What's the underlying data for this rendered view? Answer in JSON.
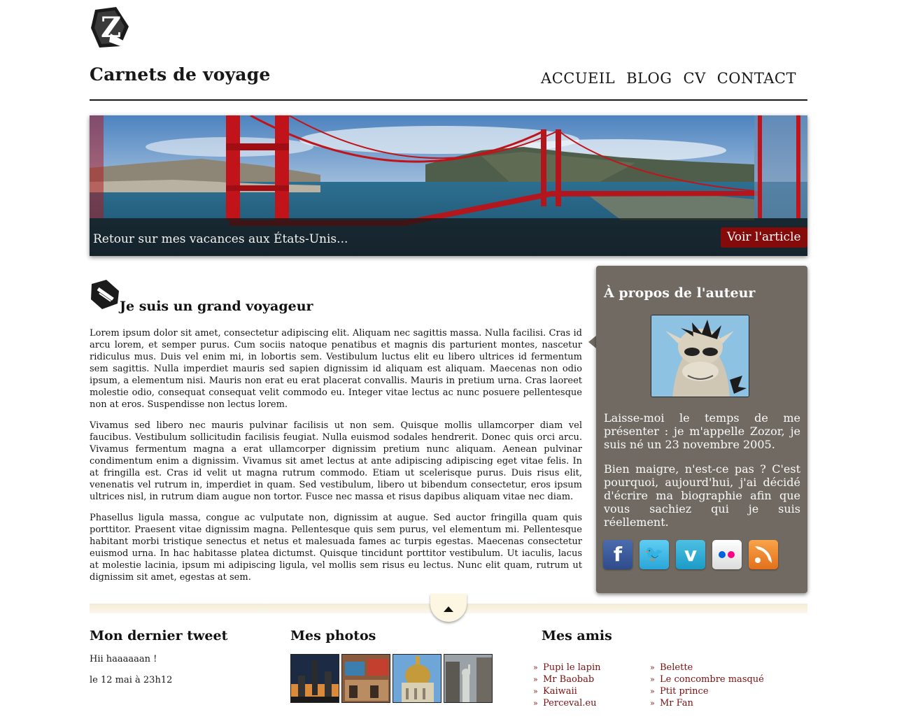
{
  "header": {
    "site_title": "Carnets de voyage",
    "nav": [
      "ACCUEIL",
      "BLOG",
      "CV",
      "CONTACT"
    ]
  },
  "banner": {
    "caption": "Retour sur mes vacances aux États-Unis...",
    "button_label": "Voir l'article"
  },
  "article": {
    "title": "Je suis un grand voyageur",
    "paragraphs": [
      "Lorem ipsum dolor sit amet, consectetur adipiscing elit. Aliquam nec sagittis massa. Nulla facilisi. Cras id arcu lorem, et semper purus. Cum sociis natoque penatibus et magnis dis parturient montes, nascetur ridiculus mus. Duis vel enim mi, in lobortis sem. Vestibulum luctus elit eu libero ultrices id fermentum sem sagittis. Nulla imperdiet mauris sed sapien dignissim id aliquam est aliquam. Maecenas non odio ipsum, a elementum nisi. Mauris non erat eu erat placerat convallis. Mauris in pretium urna. Cras laoreet molestie odio, consequat consequat velit commodo eu. Integer vitae lectus ac nunc posuere pellentesque non at eros. Suspendisse non lectus lorem.",
      "Vivamus sed libero nec mauris pulvinar facilisis ut non sem. Quisque mollis ullamcorper diam vel faucibus. Vestibulum sollicitudin facilisis feugiat. Nulla euismod sodales hendrerit. Donec quis orci arcu. Vivamus fermentum magna a erat ullamcorper dignissim pretium nunc aliquam. Aenean pulvinar condimentum enim a dignissim. Vivamus sit amet lectus at ante adipiscing adipiscing eget vitae felis. In at fringilla est. Cras id velit ut magna rutrum commodo. Etiam ut scelerisque purus. Duis risus elit, venenatis vel rutrum in, imperdiet in quam. Sed vestibulum, libero ut bibendum consectetur, eros ipsum ultrices nisl, in rutrum diam augue non tortor. Fusce nec massa et risus dapibus aliquam vitae nec diam.",
      "Phasellus ligula massa, congue ac vulputate non, dignissim at augue. Sed auctor fringilla quam quis porttitor. Praesent vitae dignissim magna. Pellentesque quis sem purus, vel elementum mi. Pellentesque habitant morbi tristique senectus et netus et malesuada fames ac turpis egestas. Maecenas consectetur euismod urna. In hac habitasse platea dictumst. Quisque tincidunt porttitor vestibulum. Ut iaculis, lacus at molestie lacinia, ipsum mi adipiscing ligula, vel mollis sem risus eu lectus. Nunc elit quam, rutrum ut dignissim sit amet, egestas at sem."
    ]
  },
  "aside": {
    "title": "À propos de l'auteur",
    "paragraphs": [
      "Laisse-moi le temps de me présenter : je m'appelle Zozor, je suis né un 23 novembre 2005.",
      "Bien maigre, n'est-ce pas ? C'est pourquoi, aujourd'hui, j'ai décidé d'écrire ma biographie afin que vous sachiez qui je suis réellement."
    ],
    "social_icons": [
      "facebook-icon",
      "twitter-icon",
      "vimeo-icon",
      "flickr-icon",
      "rss-icon"
    ]
  },
  "footer": {
    "tweet": {
      "title": "Mon dernier tweet",
      "text": "Hii haaaaaan !",
      "date": "le 12 mai à 23h12"
    },
    "photos": {
      "title": "Mes photos"
    },
    "friends": {
      "title": "Mes amis",
      "col1": [
        "Pupi le lapin",
        "Mr Baobab",
        "Kaiwaii",
        "Perceval.eu"
      ],
      "col2": [
        "Belette",
        "Le concombre masqué",
        "Ptit prince",
        "Mr Fan"
      ]
    }
  },
  "colors": {
    "accent": "#850a0a",
    "aside_bg": "#706a62",
    "link": "#7a0e0e"
  }
}
